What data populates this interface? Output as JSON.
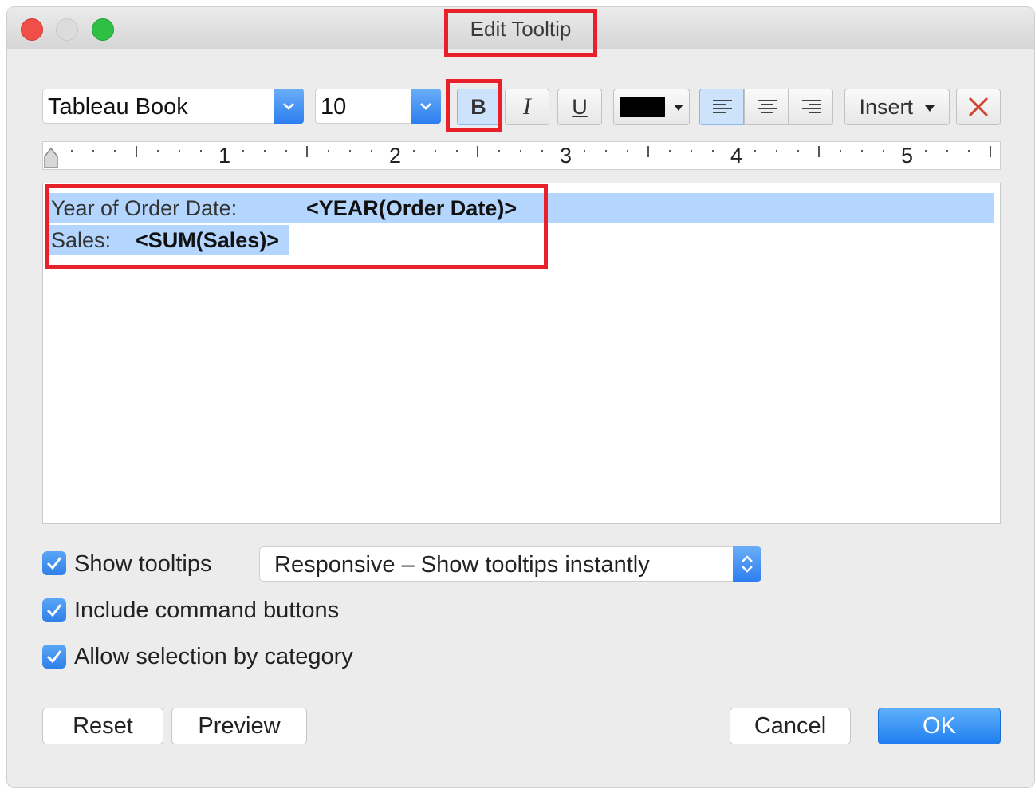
{
  "window": {
    "title": "Edit Tooltip"
  },
  "toolbar": {
    "font_family": "Tableau Book",
    "font_size": "10",
    "bold_label": "B",
    "italic_label": "I",
    "underline_label": "U",
    "text_color": "#000000",
    "insert_label": "Insert",
    "close_icon": "close-x-icon"
  },
  "ruler": {
    "marks": [
      "1",
      "2",
      "3",
      "4",
      "5"
    ]
  },
  "editor": {
    "line1_label": "Year of Order Date:",
    "line1_field": "<YEAR(Order Date)>",
    "line2_label": "Sales:",
    "line2_field": "<SUM(Sales)>"
  },
  "options": {
    "show_tooltips_label": "Show tooltips",
    "show_tooltips_checked": true,
    "tooltip_mode": "Responsive – Show tooltips instantly",
    "include_buttons_label": "Include command buttons",
    "include_buttons_checked": true,
    "allow_selection_label": "Allow selection by category",
    "allow_selection_checked": true
  },
  "buttons": {
    "reset": "Reset",
    "preview": "Preview",
    "cancel": "Cancel",
    "ok": "OK"
  },
  "colors": {
    "highlight": "#e8202a",
    "selection": "#b4d6fe",
    "accent": "#2d7ef0"
  }
}
